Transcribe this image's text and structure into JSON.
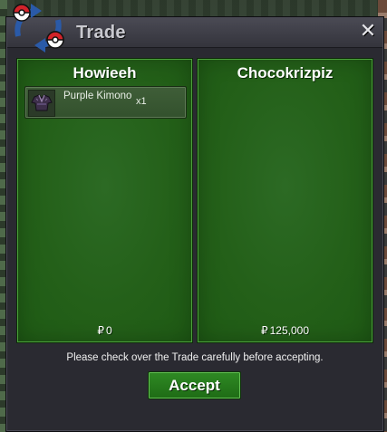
{
  "window": {
    "title": "Trade",
    "close_glyph": "✕"
  },
  "left_panel": {
    "player": "Howieeh",
    "items": [
      {
        "name": "Purple Kimono",
        "icon": "kimono-icon",
        "quantity": "x1"
      }
    ],
    "money_symbol": "₽",
    "money": "0"
  },
  "right_panel": {
    "player": "Chocokrizpiz",
    "items": [],
    "money_symbol": "₽",
    "money": "125,000"
  },
  "notice": "Please check over the Trade carefully before accepting.",
  "accept_label": "Accept",
  "colors": {
    "panel_green": "#246019",
    "button_green": "#2f8a24",
    "window_dark": "#2a2a31"
  }
}
